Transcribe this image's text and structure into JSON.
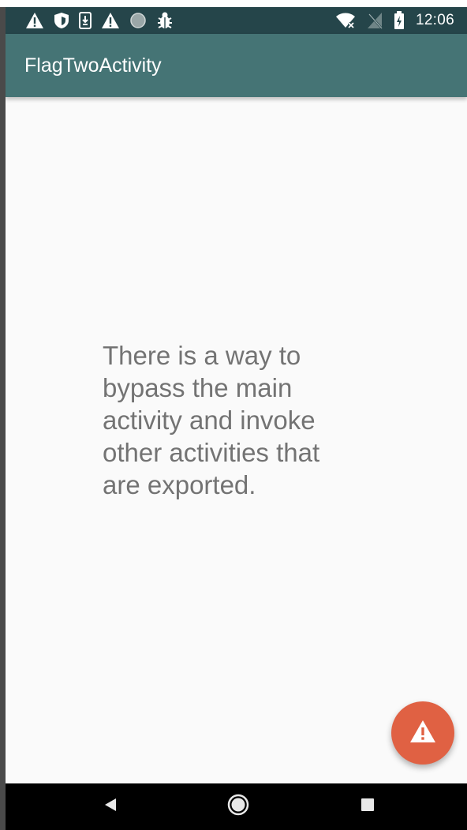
{
  "status_bar": {
    "time": "12:06",
    "left_icons": [
      "warning-icon",
      "shield-icon",
      "download-icon",
      "warning-icon",
      "circle-icon",
      "bug-icon"
    ],
    "right_icons": [
      "wifi-off-icon",
      "no-signal-icon",
      "battery-icon"
    ]
  },
  "app_bar": {
    "title": "FlagTwoActivity"
  },
  "content": {
    "message": "There is a way to bypass the main activity and invoke other activities that are exported."
  },
  "fab": {
    "icon": "warning-icon"
  },
  "nav_bar": {
    "buttons": [
      "back-icon",
      "home-icon",
      "recents-icon"
    ]
  },
  "colors": {
    "status_bar": "#25454a",
    "app_bar": "#457475",
    "fab": "#e06143",
    "background": "#fafafa",
    "text": "#737373"
  }
}
